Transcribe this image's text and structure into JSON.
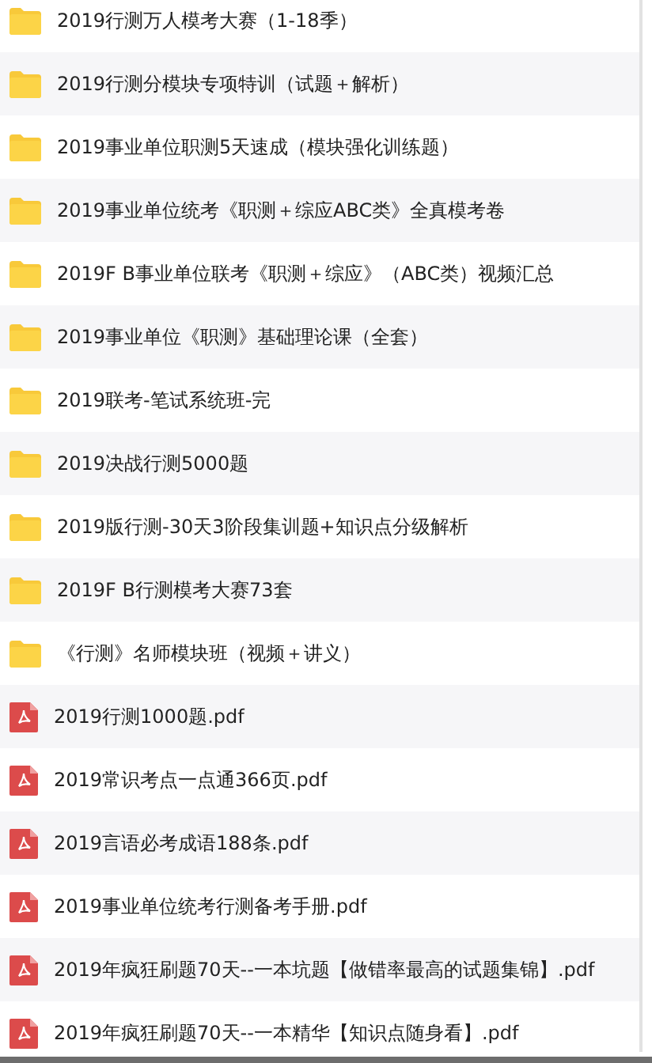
{
  "files": [
    {
      "kind": "folder",
      "name": "2019行测万人模考大赛（1-18季）"
    },
    {
      "kind": "folder",
      "name": "2019行测分模块专项特训（试题＋解析）"
    },
    {
      "kind": "folder",
      "name": "2019事业单位职测5天速成（模块强化训练题）"
    },
    {
      "kind": "folder",
      "name": "2019事业单位统考《职测＋综应ABC类》全真模考卷"
    },
    {
      "kind": "folder",
      "name": "2019F B事业单位联考《职测＋综应》（ABC类）视频汇总"
    },
    {
      "kind": "folder",
      "name": "2019事业单位《职测》基础理论课（全套）"
    },
    {
      "kind": "folder",
      "name": "2019联考-笔试系统班-完"
    },
    {
      "kind": "folder",
      "name": "2019决战行测5000题"
    },
    {
      "kind": "folder",
      "name": "2019版行测-30天3阶段集训题+知识点分级解析"
    },
    {
      "kind": "folder",
      "name": "2019F B行测模考大赛73套"
    },
    {
      "kind": "folder",
      "name": "《行测》名师模块班（视频＋讲义）"
    },
    {
      "kind": "pdf",
      "name": "2019行测1000题.pdf"
    },
    {
      "kind": "pdf",
      "name": "2019常识考点一点通366页.pdf"
    },
    {
      "kind": "pdf",
      "name": "2019言语必考成语188条.pdf"
    },
    {
      "kind": "pdf",
      "name": "2019事业单位统考行测备考手册.pdf"
    },
    {
      "kind": "pdf",
      "name": "2019年疯狂刷题70天--一本坑题【做错率最高的试题集锦】.pdf"
    },
    {
      "kind": "pdf",
      "name": "2019年疯狂刷题70天--一本精华【知识点随身看】.pdf"
    }
  ]
}
